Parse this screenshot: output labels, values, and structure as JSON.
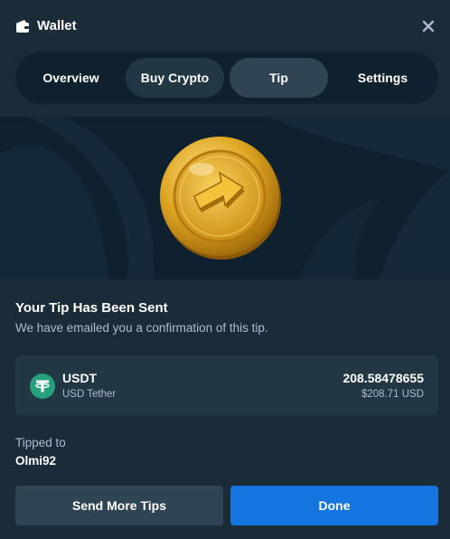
{
  "header": {
    "title": "Wallet",
    "icon": "wallet-icon",
    "close_icon": "close-icon"
  },
  "tabs": [
    {
      "label": "Overview",
      "state": "normal"
    },
    {
      "label": "Buy Crypto",
      "state": "hover"
    },
    {
      "label": "Tip",
      "state": "active"
    },
    {
      "label": "Settings",
      "state": "normal"
    }
  ],
  "hero": {
    "icon": "gold-coin-arrow-icon"
  },
  "confirmation": {
    "title": "Your Tip Has Been Sent",
    "subtitle": "We have emailed you a confirmation of this tip."
  },
  "currency": {
    "code": "USDT",
    "name": "USD Tether",
    "amount": "208.58478655",
    "fiat_value": "$208.71 USD",
    "icon": "tether-icon",
    "icon_color": "#26a17b"
  },
  "recipient": {
    "label": "Tipped to",
    "username": "Olmi92"
  },
  "actions": {
    "send_more_label": "Send More Tips",
    "done_label": "Done"
  },
  "colors": {
    "background": "#1a2c38",
    "tab_bar": "#0f212e",
    "active_tab": "#2f4553",
    "card": "#213743",
    "primary": "#1475e1",
    "muted_text": "#b1bad3"
  }
}
